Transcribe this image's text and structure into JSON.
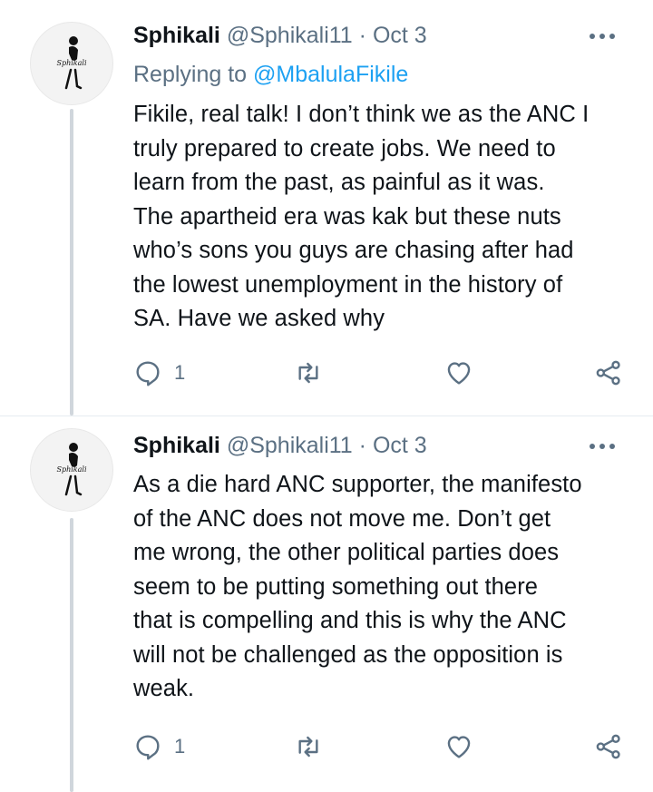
{
  "tweets": [
    {
      "name": "Sphikali",
      "handle": "@Sphikali11",
      "separator": "·",
      "date": "Oct 3",
      "replying_prefix": "Replying to",
      "replying_to": "@MbalulaFikile",
      "text": "Fikile, real talk! I don’t think we as the ANC I\ntruly prepared to create jobs. We need to\nlearn from the past, as painful as it was.\nThe apartheid era was kak but these nuts\nwho’s sons you guys are chasing after had\nthe lowest unemployment in the history of\nSA. Have we asked why",
      "reply_count": "1",
      "avatar_label": "Sphikali"
    },
    {
      "name": "Sphikali",
      "handle": "@Sphikali11",
      "separator": "·",
      "date": "Oct 3",
      "text": "As a die hard ANC supporter, the manifesto\nof the ANC does not move me. Don’t get\nme wrong, the other political parties does\nseem to be putting something out there\nthat is compelling and this is why the ANC\nwill not be challenged as the opposition is\nweak.",
      "reply_count": "1",
      "avatar_label": "Sphikali"
    }
  ],
  "icons": {
    "reply": "reply-icon",
    "retweet": "retweet-icon",
    "like": "heart-icon",
    "share": "share-icon",
    "more": "more-options-icon"
  },
  "colors": {
    "secondary_text": "#5b7083",
    "link": "#1da1f2",
    "thread_line": "#d0d6dc"
  }
}
